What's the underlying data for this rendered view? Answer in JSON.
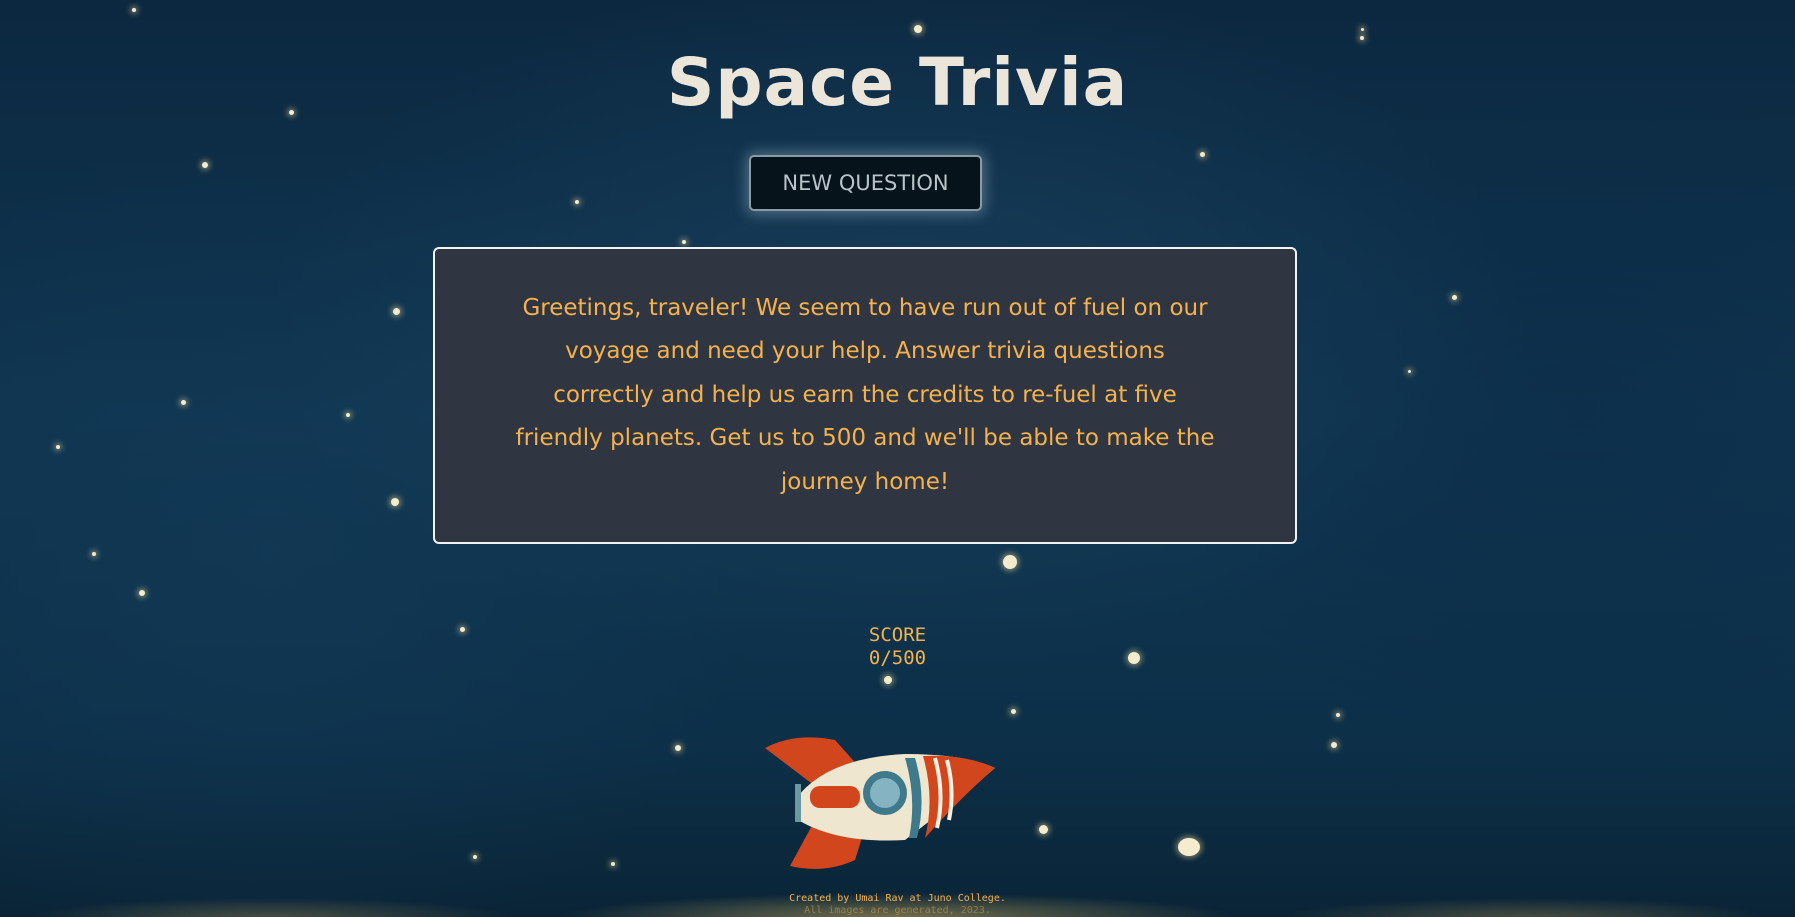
{
  "app": {
    "title": "Space Trivia",
    "new_question_label": "NEW QUESTION",
    "intro_text": "Greetings, traveler! We seem to have run out of fuel on our voyage and need your help. Answer trivia questions correctly and help us earn the credits to re-fuel at five friendly planets. Get us to 500 and we'll be able to make the journey home!",
    "score_label": "SCORE",
    "score_value": "0/500"
  },
  "footer": {
    "credit": "Created by Umai Rav at Juno College.",
    "note": "All images are generated, 2023."
  },
  "colors": {
    "accent": "#f5b24c",
    "card_bg": "#303641",
    "title": "#ece6da",
    "button_bg": "#06131b"
  },
  "icons": {
    "rocket": "rocket-icon",
    "moon": "crescent-moon-icon"
  }
}
